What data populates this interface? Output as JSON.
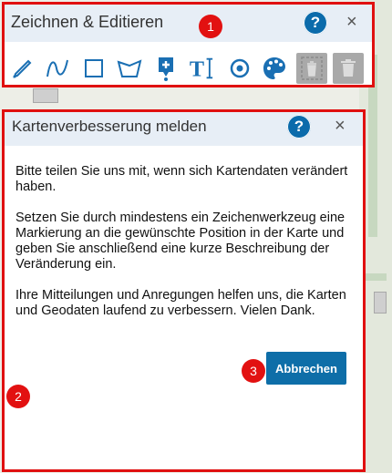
{
  "toolbar": {
    "title": "Zeichnen & Editieren",
    "help": "?",
    "close": "×",
    "tools": [
      {
        "name": "pencil-icon"
      },
      {
        "name": "freehand-curve-icon"
      },
      {
        "name": "rectangle-icon"
      },
      {
        "name": "polygon-icon"
      },
      {
        "name": "marker-add-icon"
      },
      {
        "name": "text-tool-icon"
      },
      {
        "name": "circle-target-icon"
      },
      {
        "name": "palette-icon"
      },
      {
        "name": "delete-selected-icon"
      },
      {
        "name": "trash-icon"
      }
    ]
  },
  "dialog": {
    "title": "Kartenverbesserung melden",
    "help": "?",
    "close": "×",
    "paragraphs": [
      "Bitte teilen Sie uns mit, wenn sich Kartendaten verändert haben.",
      "Setzen Sie durch mindestens ein Zeichenwerkzeug eine Markierung an die gewünschte Position in der Karte und geben Sie anschließend eine kurze Beschreibung der Veränderung ein.",
      "Ihre Mitteilungen und Anregungen helfen uns, die Karten und Geodaten laufend zu verbessern. Vielen Dank."
    ],
    "cancel_label": "Abbrechen"
  },
  "annotations": {
    "badge1": "1",
    "badge2": "2",
    "badge3": "3",
    "color": "#e21111"
  },
  "colors": {
    "accent": "#0b6bab",
    "header_bg": "#e7eef6"
  }
}
